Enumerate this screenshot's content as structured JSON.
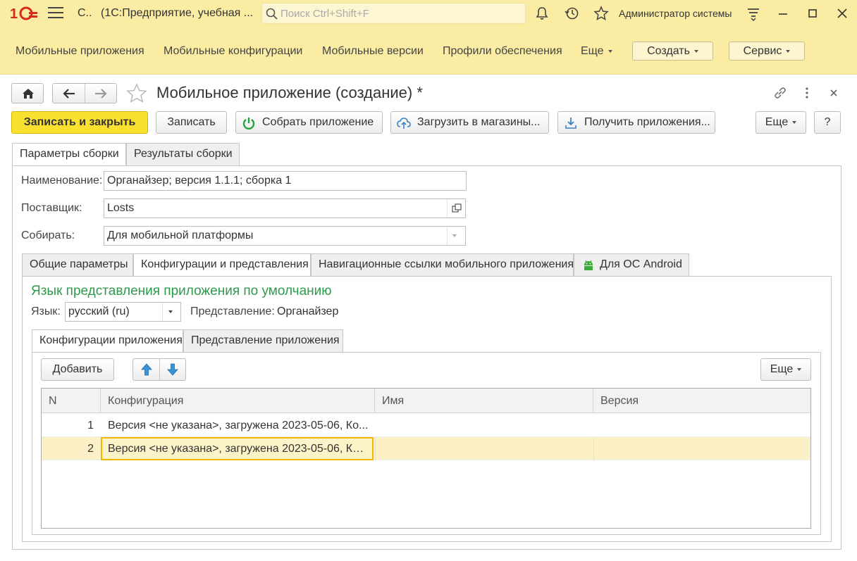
{
  "titlebar": {
    "short_title": "С..",
    "title": "(1С:Предприятие, учебная ...",
    "search_placeholder": "Поиск Ctrl+Shift+F",
    "user": "Администратор системы"
  },
  "sections": {
    "links": [
      "Мобильные приложения",
      "Мобильные конфигурации",
      "Мобильные версии",
      "Профили обеспечения"
    ],
    "more_label": "Еще",
    "create_label": "Создать",
    "service_label": "Сервис"
  },
  "form": {
    "title": "Мобильное приложение (создание) *",
    "commands": {
      "save_close": "Записать и закрыть",
      "save": "Записать",
      "build": "Собрать приложение",
      "upload": "Загрузить в магазины...",
      "get": "Получить приложения...",
      "more": "Еще",
      "help": "?"
    },
    "tabs": [
      "Параметры сборки",
      "Результаты сборки"
    ],
    "fields": {
      "name_label": "Наименование:",
      "name_value": "Органайзер; версия 1.1.1; сборка 1",
      "supplier_label": "Поставщик:",
      "supplier_value": "Losts",
      "build_label": "Собирать:",
      "build_value": "Для мобильной платформы"
    },
    "inner_tabs": [
      "Общие параметры",
      "Конфигурации и представления",
      "Навигационные ссылки мобильного приложения",
      "Для ОС Android"
    ],
    "section_title": "Язык представления приложения по умолчанию",
    "lang_label": "Язык:",
    "lang_value": "русский (ru)",
    "repr_label": "Представление:",
    "repr_value": "Органайзер",
    "sub_tabs": [
      "Конфигурации приложения",
      "Представление приложения"
    ],
    "add_label": "Добавить",
    "table_more": "Еще",
    "table": {
      "columns": [
        "N",
        "Конфигурация",
        "Имя",
        "Версия"
      ],
      "rows": [
        {
          "n": "1",
          "config": "Версия <не указана>, загружена 2023-05-06, Ко...",
          "name": "",
          "version": ""
        },
        {
          "n": "2",
          "config": "Версия <не указана>, загружена 2023-05-06, Ко...",
          "name": "",
          "version": ""
        }
      ]
    }
  }
}
